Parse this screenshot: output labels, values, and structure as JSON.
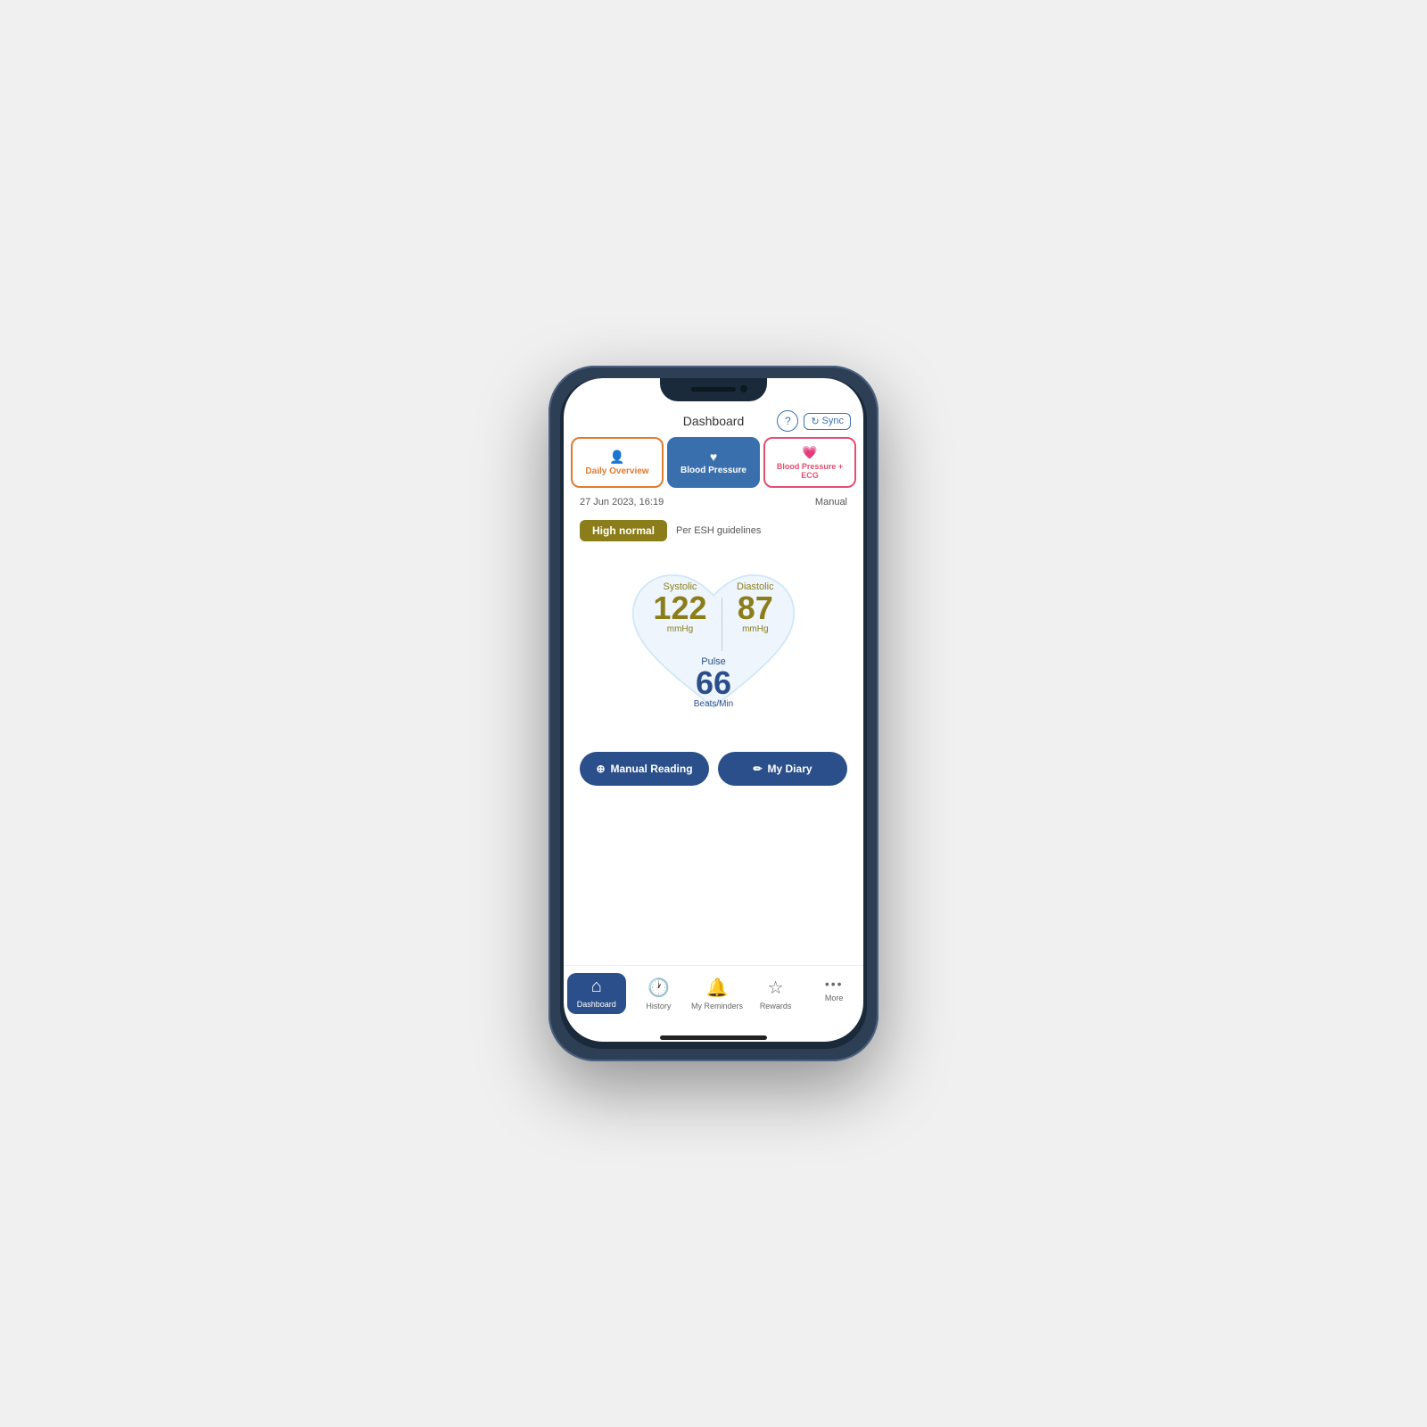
{
  "phone": {
    "header": {
      "title": "Dashboard",
      "help_label": "?",
      "sync_label": "Sync"
    },
    "tabs": [
      {
        "id": "daily",
        "label": "Daily Overview",
        "icon": "👤",
        "active": false
      },
      {
        "id": "bp",
        "label": "Blood Pressure",
        "icon": "♥",
        "active": true
      },
      {
        "id": "ecg",
        "label": "Blood Pressure + ECG",
        "icon": "💗",
        "active": false
      }
    ],
    "reading": {
      "date": "27 Jun 2023, 16:19",
      "type": "Manual",
      "status": "High normal",
      "guideline": "Per ESH guidelines",
      "systolic_label": "Systolic",
      "systolic_value": "122",
      "systolic_unit": "mmHg",
      "diastolic_label": "Diastolic",
      "diastolic_value": "87",
      "diastolic_unit": "mmHg",
      "pulse_label": "Pulse",
      "pulse_value": "66",
      "pulse_unit": "Beats/Min"
    },
    "buttons": [
      {
        "id": "manual",
        "label": "Manual Reading",
        "icon": "+"
      },
      {
        "id": "diary",
        "label": "My Diary",
        "icon": "✏"
      }
    ],
    "nav": [
      {
        "id": "dashboard",
        "label": "Dashboard",
        "icon": "🏠",
        "active": true
      },
      {
        "id": "history",
        "label": "History",
        "icon": "🕐",
        "active": false
      },
      {
        "id": "reminders",
        "label": "My Reminders",
        "icon": "🔔",
        "active": false
      },
      {
        "id": "rewards",
        "label": "Rewards",
        "icon": "☆",
        "active": false
      },
      {
        "id": "more",
        "label": "More",
        "icon": "•••",
        "active": false
      }
    ],
    "colors": {
      "accent_blue": "#2a4f8a",
      "accent_olive": "#8B7D1A",
      "accent_orange": "#e07a30",
      "accent_pink": "#e05070"
    }
  }
}
